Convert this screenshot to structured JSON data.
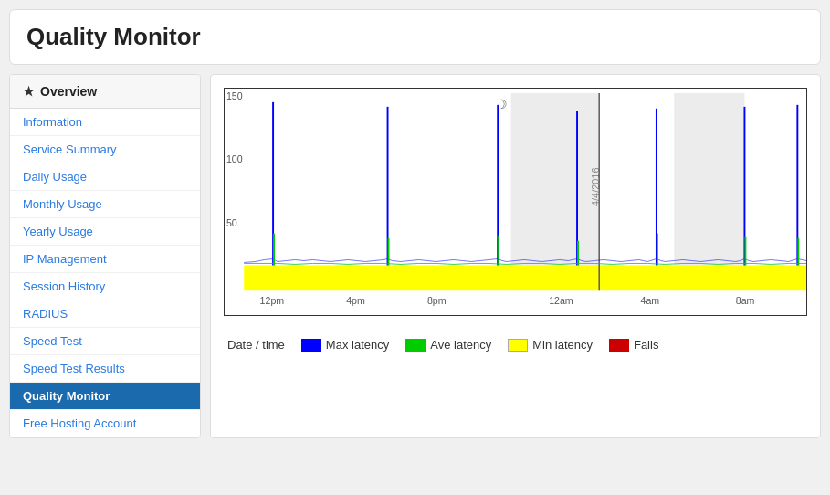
{
  "page": {
    "title": "Quality Monitor"
  },
  "sidebar": {
    "overview_label": "Overview",
    "star": "★",
    "items": [
      {
        "id": "information",
        "label": "Information",
        "active": false
      },
      {
        "id": "service-summary",
        "label": "Service Summary",
        "active": false
      },
      {
        "id": "daily-usage",
        "label": "Daily Usage",
        "active": false
      },
      {
        "id": "monthly-usage",
        "label": "Monthly Usage",
        "active": false
      },
      {
        "id": "yearly-usage",
        "label": "Yearly Usage",
        "active": false
      },
      {
        "id": "ip-management",
        "label": "IP Management",
        "active": false
      },
      {
        "id": "session-history",
        "label": "Session History",
        "active": false
      },
      {
        "id": "radius",
        "label": "RADIUS",
        "active": false
      },
      {
        "id": "speed-test",
        "label": "Speed Test",
        "active": false
      },
      {
        "id": "speed-test-results",
        "label": "Speed Test Results",
        "active": false
      },
      {
        "id": "quality-monitor",
        "label": "Quality Monitor",
        "active": true
      },
      {
        "id": "free-hosting-account",
        "label": "Free Hosting Account",
        "active": false
      }
    ]
  },
  "chart": {
    "y_labels": [
      "150",
      "100",
      "50"
    ],
    "x_labels": [
      "12pm",
      "4pm",
      "8pm",
      "12am",
      "4am",
      "8am"
    ],
    "date_label": "4/4/2016",
    "moon_symbol": "☽"
  },
  "legend": {
    "date_time": "Date / time",
    "max_label": "Max latency",
    "max_color": "#0000ff",
    "ave_label": "Ave latency",
    "ave_color": "#00cc00",
    "min_label": "Min latency",
    "min_color": "#ffff00",
    "fails_label": "Fails",
    "fails_color": "#cc0000"
  }
}
